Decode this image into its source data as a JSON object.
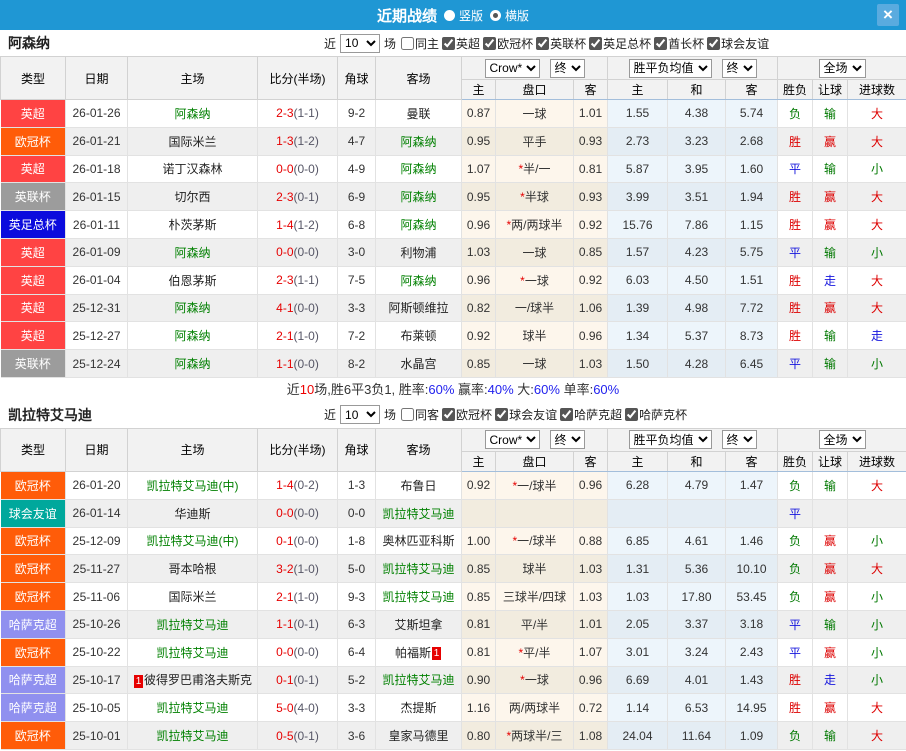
{
  "titlebar": {
    "title": "近期战绩",
    "vertical": "竖版",
    "horizontal": "横版",
    "close": "×"
  },
  "palette": {
    "word_colors": {
      "胜": "#dd0000",
      "平": "#1515dd",
      "负": "#007800",
      "赢": "#dd0000",
      "走": "#1515dd",
      "输": "#007800",
      "大": "#dd0000",
      "小": "#007800"
    },
    "badge_colors": {
      "英超": "#ff4343",
      "欧冠杯": "#ff5c09",
      "英联杯": "#9c9c9c",
      "英足总杯": "#0b0bdd",
      "球会友谊": "#00a89c",
      "哈萨克超": "#9090ef"
    }
  },
  "header_labels": {
    "cols": [
      "类型",
      "日期",
      "主场",
      "比分(半场)",
      "角球",
      "客场"
    ],
    "select_company": "Crow*",
    "select_final": "终",
    "select_avg": "胜平负均值",
    "select_scope": "全场",
    "sub": [
      "主",
      "盘口",
      "客",
      "主",
      "和",
      "客",
      "胜负",
      "让球",
      "进球数"
    ]
  },
  "sections": [
    {
      "team": "阿森纳",
      "filter": {
        "near": "近",
        "count": "10",
        "games": "场",
        "same": "同主",
        "same_checked": false,
        "leagues": [
          "英超",
          "欧冠杯",
          "英联杯",
          "英足总杯",
          "酋长杯",
          "球会友谊"
        ]
      },
      "rows": [
        {
          "type": "英超",
          "date": "26-01-26",
          "home": "阿森纳",
          "hg": true,
          "score": "2-3",
          "half": "(1-1)",
          "corner": "9-2",
          "away": "曼联",
          "ag": false,
          "o1": "0.87",
          "hc": "一球",
          "st": false,
          "o2": "1.01",
          "m1": "1.55",
          "m2": "4.38",
          "m3": "5.74",
          "r1": "负",
          "r2": "输",
          "r3": "大"
        },
        {
          "type": "欧冠杯",
          "date": "26-01-21",
          "home": "国际米兰",
          "hg": false,
          "score": "1-3",
          "half": "(1-2)",
          "corner": "4-7",
          "away": "阿森纳",
          "ag": true,
          "o1": "0.95",
          "hc": "平手",
          "st": false,
          "o2": "0.93",
          "m1": "2.73",
          "m2": "3.23",
          "m3": "2.68",
          "r1": "胜",
          "r2": "赢",
          "r3": "大"
        },
        {
          "type": "英超",
          "date": "26-01-18",
          "home": "诺丁汉森林",
          "hg": false,
          "score": "0-0",
          "half": "(0-0)",
          "corner": "4-9",
          "away": "阿森纳",
          "ag": true,
          "o1": "1.07",
          "hc": "半/一",
          "st": true,
          "o2": "0.81",
          "m1": "5.87",
          "m2": "3.95",
          "m3": "1.60",
          "r1": "平",
          "r2": "输",
          "r3": "小"
        },
        {
          "type": "英联杯",
          "date": "26-01-15",
          "home": "切尔西",
          "hg": false,
          "score": "2-3",
          "half": "(0-1)",
          "corner": "6-9",
          "away": "阿森纳",
          "ag": true,
          "o1": "0.95",
          "hc": "半球",
          "st": true,
          "o2": "0.93",
          "m1": "3.99",
          "m2": "3.51",
          "m3": "1.94",
          "r1": "胜",
          "r2": "赢",
          "r3": "大"
        },
        {
          "type": "英足总杯",
          "date": "26-01-11",
          "home": "朴茨茅斯",
          "hg": false,
          "score": "1-4",
          "half": "(1-2)",
          "corner": "6-8",
          "away": "阿森纳",
          "ag": true,
          "o1": "0.96",
          "hc": "两/两球半",
          "st": true,
          "o2": "0.92",
          "m1": "15.76",
          "m2": "7.86",
          "m3": "1.15",
          "r1": "胜",
          "r2": "赢",
          "r3": "大"
        },
        {
          "type": "英超",
          "date": "26-01-09",
          "home": "阿森纳",
          "hg": true,
          "score": "0-0",
          "half": "(0-0)",
          "corner": "3-0",
          "away": "利物浦",
          "ag": false,
          "o1": "1.03",
          "hc": "一球",
          "st": false,
          "o2": "0.85",
          "m1": "1.57",
          "m2": "4.23",
          "m3": "5.75",
          "r1": "平",
          "r2": "输",
          "r3": "小"
        },
        {
          "type": "英超",
          "date": "26-01-04",
          "home": "伯恩茅斯",
          "hg": false,
          "score": "2-3",
          "half": "(1-1)",
          "corner": "7-5",
          "away": "阿森纳",
          "ag": true,
          "o1": "0.96",
          "hc": "一球",
          "st": true,
          "o2": "0.92",
          "m1": "6.03",
          "m2": "4.50",
          "m3": "1.51",
          "r1": "胜",
          "r2": "走",
          "r3": "大"
        },
        {
          "type": "英超",
          "date": "25-12-31",
          "home": "阿森纳",
          "hg": true,
          "score": "4-1",
          "half": "(0-0)",
          "corner": "3-3",
          "away": "阿斯顿维拉",
          "ag": false,
          "o1": "0.82",
          "hc": "一/球半",
          "st": false,
          "o2": "1.06",
          "m1": "1.39",
          "m2": "4.98",
          "m3": "7.72",
          "r1": "胜",
          "r2": "赢",
          "r3": "大"
        },
        {
          "type": "英超",
          "date": "25-12-27",
          "home": "阿森纳",
          "hg": true,
          "score": "2-1",
          "half": "(1-0)",
          "corner": "7-2",
          "away": "布莱顿",
          "ag": false,
          "o1": "0.92",
          "hc": "球半",
          "st": false,
          "o2": "0.96",
          "m1": "1.34",
          "m2": "5.37",
          "m3": "8.73",
          "r1": "胜",
          "r2": "输",
          "r3": "走"
        },
        {
          "type": "英联杯",
          "date": "25-12-24",
          "home": "阿森纳",
          "hg": true,
          "score": "1-1",
          "half": "(0-0)",
          "corner": "8-2",
          "away": "水晶宫",
          "ag": false,
          "o1": "0.85",
          "hc": "一球",
          "st": false,
          "o2": "1.03",
          "m1": "1.50",
          "m2": "4.28",
          "m3": "6.45",
          "r1": "平",
          "r2": "输",
          "r3": "小"
        }
      ],
      "summary": [
        {
          "t": "近",
          "c": "#333333"
        },
        {
          "t": "10",
          "c": "#ee0000"
        },
        {
          "t": "场,胜6平3负1, 胜率:",
          "c": "#333333"
        },
        {
          "t": "60%",
          "c": "#2222ee"
        },
        {
          "t": " 赢率:",
          "c": "#333333"
        },
        {
          "t": "40%",
          "c": "#2222ee"
        },
        {
          "t": " 大:",
          "c": "#333333"
        },
        {
          "t": "60%",
          "c": "#2222ee"
        },
        {
          "t": " 单率:",
          "c": "#333333"
        },
        {
          "t": "60%",
          "c": "#2222ee"
        }
      ]
    },
    {
      "team": "凯拉特艾马迪",
      "filter": {
        "near": "近",
        "count": "10",
        "games": "场",
        "same": "同客",
        "same_checked": false,
        "leagues": [
          "欧冠杯",
          "球会友谊",
          "哈萨克超",
          "哈萨克杯"
        ]
      },
      "rows": [
        {
          "type": "欧冠杯",
          "date": "26-01-20",
          "home": "凯拉特艾马迪(中)",
          "hg": true,
          "score": "1-4",
          "half": "(0-2)",
          "corner": "1-3",
          "away": "布鲁日",
          "ag": false,
          "o1": "0.92",
          "hc": "一/球半",
          "st": true,
          "o2": "0.96",
          "m1": "6.28",
          "m2": "4.79",
          "m3": "1.47",
          "r1": "负",
          "r2": "输",
          "r3": "大"
        },
        {
          "type": "球会友谊",
          "date": "26-01-14",
          "home": "华迪斯",
          "hg": false,
          "score": "0-0",
          "half": "(0-0)",
          "corner": "0-0",
          "away": "凯拉特艾马迪",
          "ag": true,
          "o1": "",
          "hc": "",
          "st": false,
          "o2": "",
          "m1": "",
          "m2": "",
          "m3": "",
          "r1": "平",
          "r2": "",
          "r3": ""
        },
        {
          "type": "欧冠杯",
          "date": "25-12-09",
          "home": "凯拉特艾马迪(中)",
          "hg": true,
          "score": "0-1",
          "half": "(0-0)",
          "corner": "1-8",
          "away": "奥林匹亚科斯",
          "ag": false,
          "o1": "1.00",
          "hc": "一/球半",
          "st": true,
          "o2": "0.88",
          "m1": "6.85",
          "m2": "4.61",
          "m3": "1.46",
          "r1": "负",
          "r2": "赢",
          "r3": "小"
        },
        {
          "type": "欧冠杯",
          "date": "25-11-27",
          "home": "哥本哈根",
          "hg": false,
          "score": "3-2",
          "half": "(1-0)",
          "corner": "5-0",
          "away": "凯拉特艾马迪",
          "ag": true,
          "o1": "0.85",
          "hc": "球半",
          "st": false,
          "o2": "1.03",
          "m1": "1.31",
          "m2": "5.36",
          "m3": "10.10",
          "r1": "负",
          "r2": "赢",
          "r3": "大"
        },
        {
          "type": "欧冠杯",
          "date": "25-11-06",
          "home": "国际米兰",
          "hg": false,
          "score": "2-1",
          "half": "(1-0)",
          "corner": "9-3",
          "away": "凯拉特艾马迪",
          "ag": true,
          "o1": "0.85",
          "hc": "三球半/四球",
          "st": false,
          "o2": "1.03",
          "m1": "1.03",
          "m2": "17.80",
          "m3": "53.45",
          "r1": "负",
          "r2": "赢",
          "r3": "小"
        },
        {
          "type": "哈萨克超",
          "date": "25-10-26",
          "home": "凯拉特艾马迪",
          "hg": true,
          "score": "1-1",
          "half": "(0-1)",
          "corner": "6-3",
          "away": "艾斯坦拿",
          "ag": false,
          "o1": "0.81",
          "hc": "平/半",
          "st": false,
          "o2": "1.01",
          "m1": "2.05",
          "m2": "3.37",
          "m3": "3.18",
          "r1": "平",
          "r2": "输",
          "r3": "小"
        },
        {
          "type": "欧冠杯",
          "date": "25-10-22",
          "home": "凯拉特艾马迪",
          "hg": true,
          "score": "0-0",
          "half": "(0-0)",
          "corner": "6-4",
          "away": "帕福斯",
          "ag": false,
          "ab": "1",
          "o1": "0.81",
          "hc": "平/半",
          "st": true,
          "o2": "1.07",
          "m1": "3.01",
          "m2": "3.24",
          "m3": "2.43",
          "r1": "平",
          "r2": "赢",
          "r3": "小"
        },
        {
          "type": "哈萨克超",
          "date": "25-10-17",
          "home": "彼得罗巴甫洛夫斯克",
          "hg": false,
          "hb": "1",
          "score": "0-1",
          "half": "(0-1)",
          "corner": "5-2",
          "away": "凯拉特艾马迪",
          "ag": true,
          "o1": "0.90",
          "hc": "一球",
          "st": true,
          "o2": "0.96",
          "m1": "6.69",
          "m2": "4.01",
          "m3": "1.43",
          "r1": "胜",
          "r2": "走",
          "r3": "小"
        },
        {
          "type": "哈萨克超",
          "date": "25-10-05",
          "home": "凯拉特艾马迪",
          "hg": true,
          "score": "5-0",
          "half": "(4-0)",
          "corner": "3-3",
          "away": "杰提斯",
          "ag": false,
          "o1": "1.16",
          "hc": "两/两球半",
          "st": false,
          "o2": "0.72",
          "m1": "1.14",
          "m2": "6.53",
          "m3": "14.95",
          "r1": "胜",
          "r2": "赢",
          "r3": "大"
        },
        {
          "type": "欧冠杯",
          "date": "25-10-01",
          "home": "凯拉特艾马迪",
          "hg": true,
          "score": "0-5",
          "half": "(0-1)",
          "corner": "3-6",
          "away": "皇家马德里",
          "ag": false,
          "o1": "0.80",
          "hc": "两球半/三",
          "st": true,
          "o2": "1.08",
          "m1": "24.04",
          "m2": "11.64",
          "m3": "1.09",
          "r1": "负",
          "r2": "输",
          "r3": "大"
        }
      ]
    }
  ]
}
